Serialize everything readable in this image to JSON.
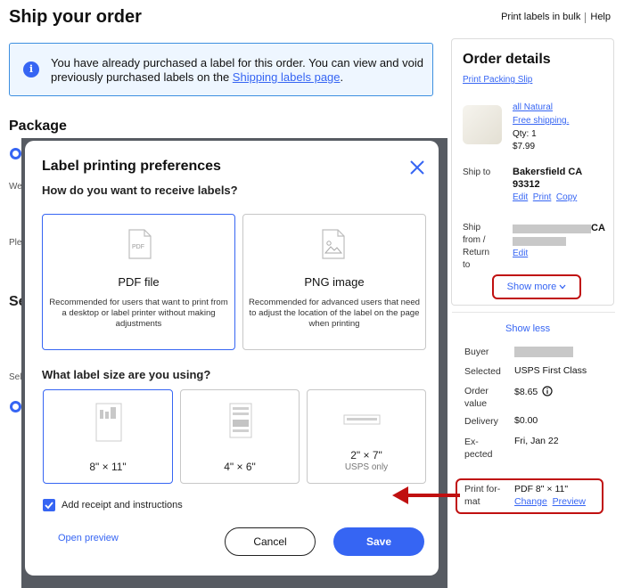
{
  "page": {
    "title": "Ship your order",
    "top_links": [
      "Print labels in bulk",
      "Help"
    ]
  },
  "banner": {
    "text": "You have already purchased a label for this order. You can view and void previously purchased labels on the ",
    "link": "Shipping labels page",
    "suffix": "."
  },
  "background": {
    "package_title": "Package",
    "fragments": [
      "We",
      "Ple",
      "Se",
      "Sel",
      "E"
    ]
  },
  "modal": {
    "title": "Label printing preferences",
    "question_receive": "How do you want to receive labels?",
    "formats": [
      {
        "name": "PDF file",
        "icon_text": "PDF",
        "desc": "Recommended for users that want to print from a desktop or label printer without making adjustments",
        "selected": true
      },
      {
        "name": "PNG image",
        "icon_text": "",
        "desc": "Recommended for advanced users that need to adjust the location of the label on the page when printing",
        "selected": false
      }
    ],
    "question_size": "What label size are you using?",
    "sizes": [
      {
        "label": "8\" × 11\"",
        "sub": "",
        "selected": true
      },
      {
        "label": "4\" × 6\"",
        "sub": "",
        "selected": false
      },
      {
        "label": "2\" × 7\"",
        "sub": "USPS only",
        "selected": false
      }
    ],
    "checkbox_label": "Add receipt and instructions",
    "checkbox_checked": true,
    "open_preview": "Open preview",
    "cancel": "Cancel",
    "save": "Save"
  },
  "order": {
    "title": "Order details",
    "print_packing": "Print Packing Slip",
    "item_name": "all Natural",
    "free_shipping": "Free shipping.",
    "qty": "Qty: 1",
    "price": "$7.99",
    "ship_to_label": "Ship to",
    "ship_to_city": "Bakersfield CA",
    "ship_to_zip": "93312",
    "ship_to_actions": [
      "Edit",
      "Print",
      "Copy"
    ],
    "ship_from_label": [
      "Ship",
      "from /",
      "Return",
      "to"
    ],
    "ship_from_state": "CA",
    "ship_from_edit": "Edit",
    "show_more": "Show more"
  },
  "summary": {
    "show_less": "Show less",
    "buyer_label": "Buyer",
    "selected_label": "Selected",
    "selected_value": "USPS First Class",
    "order_value_label": [
      "Order",
      "value"
    ],
    "order_value": "$8.65",
    "delivery_label": "Delivery",
    "delivery_value": "$0.00",
    "expected_label": [
      "Ex-",
      "pected"
    ],
    "expected_value": "Fri, Jan 22",
    "print_format_label": [
      "Print for-",
      "mat"
    ],
    "print_format_value": "PDF 8\" × 11\"",
    "change": "Change",
    "preview": "Preview"
  },
  "colors": {
    "accent": "#3665f3",
    "annotation_red": "#c01010",
    "overlay": "#575b62"
  }
}
